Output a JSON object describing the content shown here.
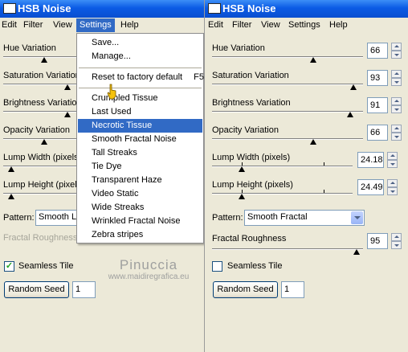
{
  "left": {
    "title": "HSB Noise",
    "menu": [
      "Edit",
      "Filter",
      "View",
      "Settings",
      "Help"
    ],
    "labels": {
      "hue": "Hue Variation",
      "saturation": "Saturation Variation",
      "brightness": "Brightness Variation",
      "opacity": "Opacity Variation",
      "lump_width": "Lump Width (pixels",
      "lump_height": "Lump Height (pixels",
      "pattern": "Pattern:",
      "fractal_roughness": "Fractal Roughness"
    },
    "pattern_value": "Smooth L",
    "seamless_label": "Seamless Tile",
    "seamless_checked": true,
    "random_seed_label": "Random Seed",
    "random_seed_value": "1"
  },
  "dropdown": {
    "items": [
      {
        "label": "Save...",
        "accel": ""
      },
      {
        "label": "Manage...",
        "accel": ""
      },
      {
        "label": "Reset to factory default",
        "accel": "F5"
      },
      {
        "label": "Crumpled Tissue",
        "accel": ""
      },
      {
        "label": "Last Used",
        "accel": ""
      },
      {
        "label": "Necrotic Tissue",
        "accel": "",
        "highlighted": true
      },
      {
        "label": "Smooth Fractal Noise",
        "accel": ""
      },
      {
        "label": "Tall Streaks",
        "accel": ""
      },
      {
        "label": "Tie Dye",
        "accel": ""
      },
      {
        "label": "Transparent Haze",
        "accel": ""
      },
      {
        "label": "Video Static",
        "accel": ""
      },
      {
        "label": "Wide Streaks",
        "accel": ""
      },
      {
        "label": "Wrinkled Fractal Noise",
        "accel": ""
      },
      {
        "label": "Zebra stripes",
        "accel": ""
      }
    ]
  },
  "right": {
    "title": "HSB Noise",
    "menu": [
      "Edit",
      "Filter",
      "View",
      "Settings",
      "Help"
    ],
    "labels": {
      "hue": "Hue Variation",
      "saturation": "Saturation Variation",
      "brightness": "Brightness Variation",
      "opacity": "Opacity Variation",
      "lump_width": "Lump Width (pixels)",
      "lump_height": "Lump Height (pixels)",
      "pattern": "Pattern:",
      "fractal_roughness": "Fractal Roughness"
    },
    "values": {
      "hue": "66",
      "saturation": "93",
      "brightness": "91",
      "opacity": "66",
      "lump_width": "24.18",
      "lump_height": "24.49",
      "fractal_roughness": "95"
    },
    "pattern_value": "Smooth Fractal",
    "seamless_label": "Seamless Tile",
    "seamless_checked": false,
    "random_seed_label": "Random Seed",
    "random_seed_value": "1"
  },
  "watermark": {
    "line1": "Pinuccia",
    "line2": "www.maidiregrafica.eu"
  }
}
